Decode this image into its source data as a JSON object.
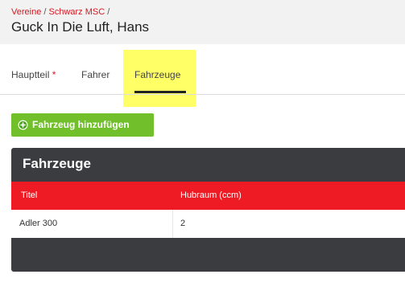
{
  "breadcrumb": {
    "items": [
      "Vereine",
      "Schwarz MSC"
    ],
    "separator": "/"
  },
  "page_title": "Guck In Die Luft, Hans",
  "tabs": [
    {
      "label": "Hauptteil",
      "required_marker": "*",
      "active": false
    },
    {
      "label": "Fahrer",
      "active": false
    },
    {
      "label": "Fahrzeuge",
      "active": true
    }
  ],
  "add_button": {
    "label": "Fahrzeug hinzufügen",
    "icon": "plus-circle-icon",
    "color": "#70bf2b"
  },
  "panel": {
    "title": "Fahrzeuge",
    "background": "#3b3c40"
  },
  "table": {
    "header_color": "#ee1b24",
    "columns": [
      "Titel",
      "Hubraum (ccm)"
    ],
    "rows": [
      [
        "Adler 300",
        "2"
      ]
    ]
  },
  "colors": {
    "accent_red": "#d11a24",
    "highlight": "#ffff66"
  }
}
